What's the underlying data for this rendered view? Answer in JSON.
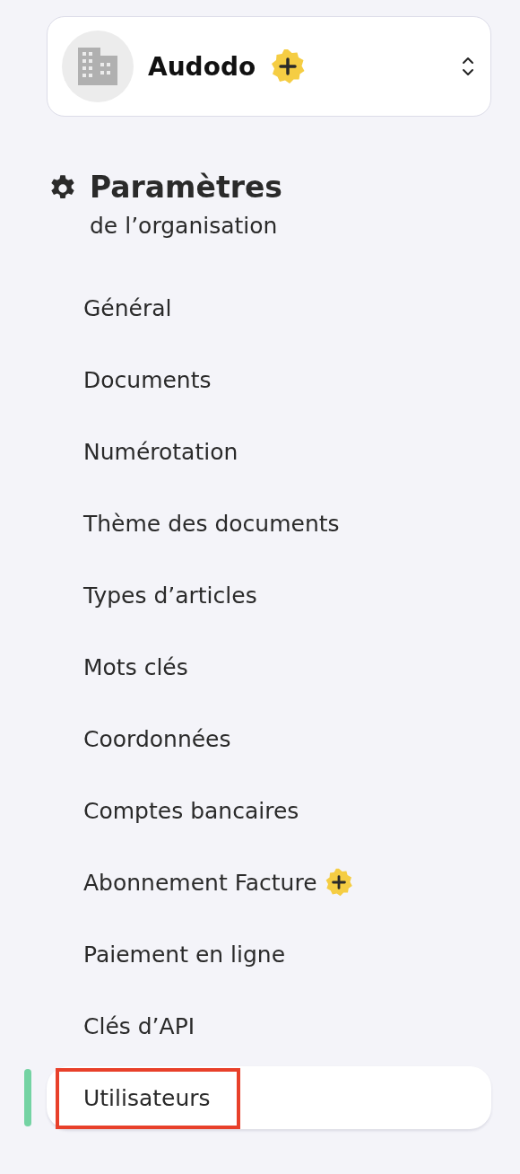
{
  "org_switcher": {
    "name": "Audodo",
    "premium": true
  },
  "section": {
    "title": "Paramètres",
    "subtitle": "de l’organisation"
  },
  "nav_items": [
    {
      "label": "Général",
      "selected": false,
      "premium": false,
      "highlighted": false
    },
    {
      "label": "Documents",
      "selected": false,
      "premium": false,
      "highlighted": false
    },
    {
      "label": "Numérotation",
      "selected": false,
      "premium": false,
      "highlighted": false
    },
    {
      "label": "Thème des documents",
      "selected": false,
      "premium": false,
      "highlighted": false
    },
    {
      "label": "Types d’articles",
      "selected": false,
      "premium": false,
      "highlighted": false
    },
    {
      "label": "Mots clés",
      "selected": false,
      "premium": false,
      "highlighted": false
    },
    {
      "label": "Coordonnées",
      "selected": false,
      "premium": false,
      "highlighted": false
    },
    {
      "label": "Comptes bancaires",
      "selected": false,
      "premium": false,
      "highlighted": false
    },
    {
      "label": "Abonnement Facture",
      "selected": false,
      "premium": true,
      "highlighted": false
    },
    {
      "label": "Paiement en ligne",
      "selected": false,
      "premium": false,
      "highlighted": false
    },
    {
      "label": "Clés d’API",
      "selected": false,
      "premium": false,
      "highlighted": false
    },
    {
      "label": "Utilisateurs",
      "selected": true,
      "premium": false,
      "highlighted": true
    }
  ]
}
